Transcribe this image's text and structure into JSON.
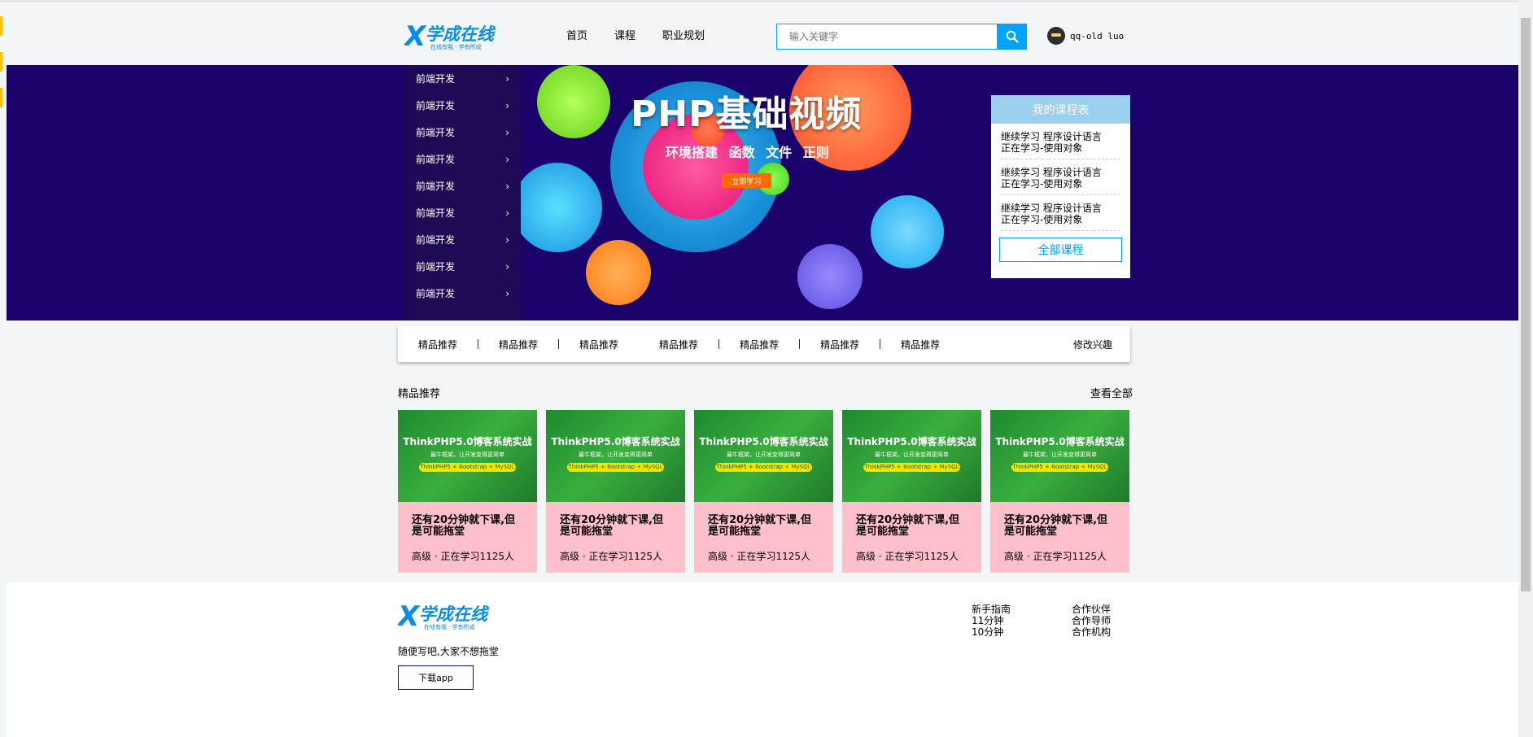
{
  "brand": {
    "name": "学成在线",
    "slogan": "在线有我 · 学有所成"
  },
  "nav": [
    "首页",
    "课程",
    "职业规划"
  ],
  "search": {
    "placeholder": "输入关键字"
  },
  "user": {
    "name": "qq-old luo"
  },
  "categories": [
    "前端开发",
    "前端开发",
    "前端开发",
    "前端开发",
    "前端开发",
    "前端开发",
    "前端开发",
    "前端开发",
    "前端开发"
  ],
  "banner": {
    "title": "PHP基础视频",
    "subtitle": "环境搭建  函数  文件  正则",
    "button": "立即学习"
  },
  "my_courses": {
    "title": "我的课程表",
    "items": [
      {
        "line1": "继续学习 程序设计语言",
        "line2": "正在学习-使用对象"
      },
      {
        "line1": "继续学习 程序设计语言",
        "line2": "正在学习-使用对象"
      },
      {
        "line1": "继续学习 程序设计语言",
        "line2": "正在学习-使用对象"
      }
    ],
    "all_label": "全部课程"
  },
  "recommend_bar": {
    "items": [
      "精品推荐",
      "精品推荐",
      "精品推荐",
      "精品推荐",
      "精品推荐",
      "精品推荐",
      "精品推荐"
    ],
    "edit_label": "修改兴趣"
  },
  "section": {
    "title": "精品推荐",
    "see_all": "查看全部"
  },
  "course_image": {
    "title": "ThinkPHP5.0博客系统实战",
    "subtitle": "最牛框架，让开发变得更简单",
    "tag": "ThinkPHP5 + Bootstrap + MySQL"
  },
  "cards": [
    {
      "title": "还有20分钟就下课,但是可能拖堂",
      "meta": "高级  ·  正在学习1125人"
    },
    {
      "title": "还有20分钟就下课,但是可能拖堂",
      "meta": "高级  ·  正在学习1125人"
    },
    {
      "title": "还有20分钟就下课,但是可能拖堂",
      "meta": "高级  ·  正在学习1125人"
    },
    {
      "title": "还有20分钟就下课,但是可能拖堂",
      "meta": "高级  ·  正在学习1125人"
    },
    {
      "title": "还有20分钟就下课,但是可能拖堂",
      "meta": "高级  ·  正在学习1125人"
    }
  ],
  "footer": {
    "desc": "随便写吧,大家不想拖堂",
    "download": "下载app",
    "col1": [
      "新手指南",
      "11分钟",
      "10分钟"
    ],
    "col2": [
      "合作伙伴",
      "合作导师",
      "合作机构"
    ]
  },
  "colors": {
    "accent": "#00a4ff",
    "banner_bg": "#1c036c",
    "card_body": "#ffc0cb"
  }
}
